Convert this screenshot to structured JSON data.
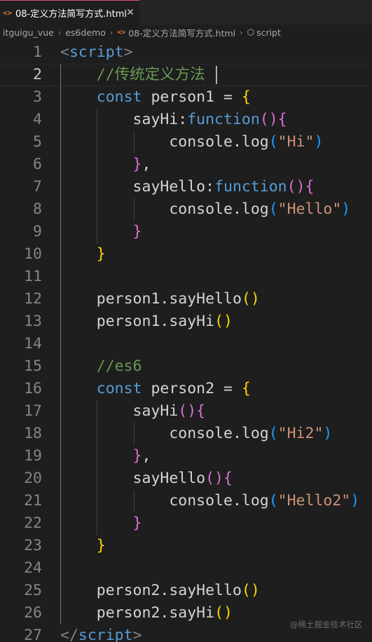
{
  "tab": {
    "icon": "html-file-icon",
    "label": "08-定义方法简写方式.html",
    "close_symbol": "✕",
    "accent_color": "#e04a8a"
  },
  "breadcrumb": {
    "items": [
      "itguigu_vue",
      "es6demo",
      "08-定义方法简写方式.html",
      "script"
    ],
    "separator": "›"
  },
  "editor": {
    "current_line": 2,
    "lines": [
      {
        "n": "1",
        "tokens": [
          [
            "t-punc",
            "<"
          ],
          [
            "t-tag",
            "script"
          ],
          [
            "t-punc",
            ">"
          ]
        ]
      },
      {
        "n": "2",
        "tokens": [
          [
            "t-comment",
            "    //传统定义方法"
          ]
        ]
      },
      {
        "n": "3",
        "tokens": [
          [
            "t-kw",
            "    const"
          ],
          [
            "t-var",
            " person1 = "
          ],
          [
            "t-br1",
            "{"
          ]
        ]
      },
      {
        "n": "4",
        "tokens": [
          [
            "t-var",
            "        sayHi:"
          ],
          [
            "t-kw",
            "function"
          ],
          [
            "t-br2",
            "()"
          ],
          [
            "t-br2",
            "{"
          ]
        ]
      },
      {
        "n": "5",
        "tokens": [
          [
            "t-var",
            "            console.log"
          ],
          [
            "t-br3",
            "("
          ],
          [
            "t-str",
            "\"Hi\""
          ],
          [
            "t-br3",
            ")"
          ]
        ]
      },
      {
        "n": "6",
        "tokens": [
          [
            "t-br2",
            "        }"
          ],
          [
            "t-var",
            ","
          ]
        ]
      },
      {
        "n": "7",
        "tokens": [
          [
            "t-var",
            "        sayHello:"
          ],
          [
            "t-kw",
            "function"
          ],
          [
            "t-br2",
            "()"
          ],
          [
            "t-br2",
            "{"
          ]
        ]
      },
      {
        "n": "8",
        "tokens": [
          [
            "t-var",
            "            console.log"
          ],
          [
            "t-br3",
            "("
          ],
          [
            "t-str",
            "\"Hello\""
          ],
          [
            "t-br3",
            ")"
          ]
        ]
      },
      {
        "n": "9",
        "tokens": [
          [
            "t-br2",
            "        }"
          ]
        ]
      },
      {
        "n": "10",
        "tokens": [
          [
            "t-br1",
            "    }"
          ]
        ]
      },
      {
        "n": "11",
        "tokens": []
      },
      {
        "n": "12",
        "tokens": [
          [
            "t-var",
            "    person1.sayHello"
          ],
          [
            "t-br1",
            "()"
          ]
        ]
      },
      {
        "n": "13",
        "tokens": [
          [
            "t-var",
            "    person1.sayHi"
          ],
          [
            "t-br1",
            "()"
          ]
        ]
      },
      {
        "n": "14",
        "tokens": []
      },
      {
        "n": "15",
        "tokens": [
          [
            "t-comment",
            "    //es6"
          ]
        ]
      },
      {
        "n": "16",
        "tokens": [
          [
            "t-kw",
            "    const"
          ],
          [
            "t-var",
            " person2 = "
          ],
          [
            "t-br1",
            "{"
          ]
        ]
      },
      {
        "n": "17",
        "tokens": [
          [
            "t-var",
            "        sayHi"
          ],
          [
            "t-br2",
            "()"
          ],
          [
            "t-br2",
            "{"
          ]
        ]
      },
      {
        "n": "18",
        "tokens": [
          [
            "t-var",
            "            console.log"
          ],
          [
            "t-br3",
            "("
          ],
          [
            "t-str",
            "\"Hi2\""
          ],
          [
            "t-br3",
            ")"
          ]
        ]
      },
      {
        "n": "19",
        "tokens": [
          [
            "t-br2",
            "        }"
          ],
          [
            "t-var",
            ","
          ]
        ]
      },
      {
        "n": "20",
        "tokens": [
          [
            "t-var",
            "        sayHello"
          ],
          [
            "t-br2",
            "()"
          ],
          [
            "t-br2",
            "{"
          ]
        ]
      },
      {
        "n": "21",
        "tokens": [
          [
            "t-var",
            "            console.log"
          ],
          [
            "t-br3",
            "("
          ],
          [
            "t-str",
            "\"Hello2\""
          ],
          [
            "t-br3",
            ")"
          ]
        ]
      },
      {
        "n": "22",
        "tokens": [
          [
            "t-br2",
            "        }"
          ]
        ]
      },
      {
        "n": "23",
        "tokens": [
          [
            "t-br1",
            "    }"
          ]
        ]
      },
      {
        "n": "24",
        "tokens": []
      },
      {
        "n": "25",
        "tokens": [
          [
            "t-var",
            "    person2.sayHello"
          ],
          [
            "t-br1",
            "()"
          ]
        ]
      },
      {
        "n": "26",
        "tokens": [
          [
            "t-var",
            "    person2.sayHi"
          ],
          [
            "t-br1",
            "()"
          ]
        ]
      },
      {
        "n": "27",
        "tokens": [
          [
            "t-punc",
            "</"
          ],
          [
            "t-tag",
            "script"
          ],
          [
            "t-punc",
            ">"
          ]
        ]
      }
    ]
  },
  "watermark": "@稀土掘金技术社区"
}
